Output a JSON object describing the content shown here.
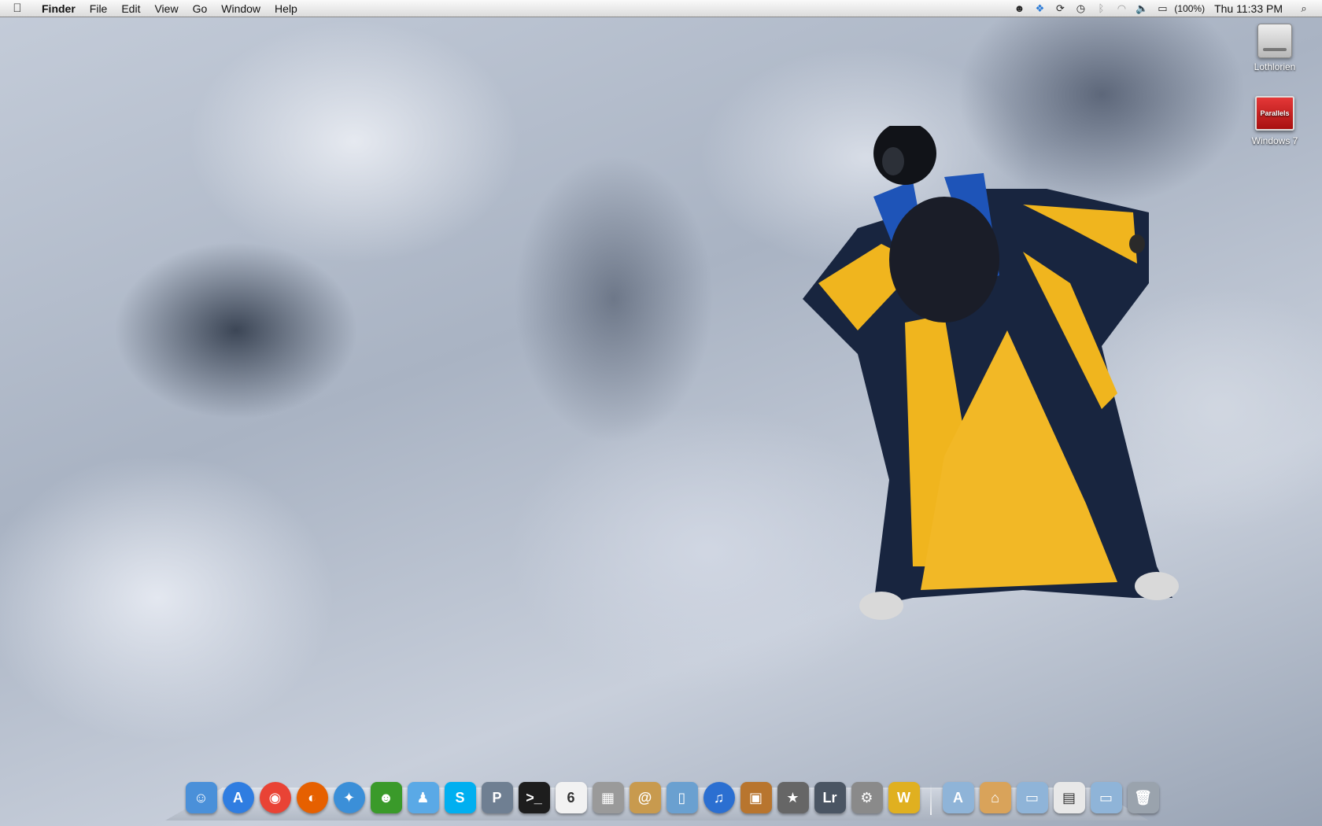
{
  "menubar": {
    "apple_icon": "apple-icon",
    "app_name": "Finder",
    "menus": [
      "File",
      "Edit",
      "View",
      "Go",
      "Window",
      "Help"
    ],
    "status_icons": [
      "monitor-app-icon",
      "dropbox-icon",
      "sync-icon",
      "time-machine-icon",
      "bluetooth-icon",
      "wifi-icon",
      "volume-icon",
      "battery-icon"
    ],
    "battery_percent": "(100%)",
    "clock": "Thu 11:33 PM",
    "spotlight_icon": "spotlight-search-icon"
  },
  "desktop_icons": [
    {
      "label": "Lothlorien",
      "icon": "hard-disk-icon"
    },
    {
      "label": "Windows 7",
      "icon": "parallels-vm-icon",
      "badge": "Parallels"
    }
  ],
  "wallpaper": "wingsuit flyer over clouds",
  "dock": {
    "apps": [
      {
        "name": "finder",
        "glyph": "☺",
        "color": "#4a90d9"
      },
      {
        "name": "app-store",
        "glyph": "A",
        "color": "#2f7de1"
      },
      {
        "name": "chrome",
        "glyph": "◉",
        "color": "#e94335"
      },
      {
        "name": "firefox",
        "glyph": "◐",
        "color": "#e66000"
      },
      {
        "name": "safari",
        "glyph": "✦",
        "color": "#3b8fd8"
      },
      {
        "name": "adium",
        "glyph": "☻",
        "color": "#3a9a2a"
      },
      {
        "name": "messenger",
        "glyph": "♟",
        "color": "#5aa9e6"
      },
      {
        "name": "skype",
        "glyph": "S",
        "color": "#00aff0"
      },
      {
        "name": "pandora",
        "glyph": "P",
        "color": "#6f7f92"
      },
      {
        "name": "terminal",
        "glyph": ">_",
        "color": "#1d1d1d"
      },
      {
        "name": "ical",
        "glyph": "6",
        "color": "#f2f2f2"
      },
      {
        "name": "calculator",
        "glyph": "▦",
        "color": "#9a9a9a"
      },
      {
        "name": "address-book",
        "glyph": "@",
        "color": "#c89a4e"
      },
      {
        "name": "preview",
        "glyph": "▯",
        "color": "#6aa0d0"
      },
      {
        "name": "itunes",
        "glyph": "♫",
        "color": "#2b6fd1"
      },
      {
        "name": "iphoto",
        "glyph": "▣",
        "color": "#b8752e"
      },
      {
        "name": "imovie",
        "glyph": "★",
        "color": "#666666"
      },
      {
        "name": "lightroom",
        "glyph": "Lr",
        "color": "#4a5563"
      },
      {
        "name": "system-preferences",
        "glyph": "⚙",
        "color": "#8a8a8a"
      },
      {
        "name": "winamp",
        "glyph": "W",
        "color": "#e0b020"
      }
    ],
    "folders": [
      {
        "name": "applications-folder",
        "glyph": "A",
        "color": "#8fb4d8"
      },
      {
        "name": "home-folder",
        "glyph": "⌂",
        "color": "#d9a35a"
      },
      {
        "name": "documents-folder",
        "glyph": "▭",
        "color": "#8fb4d8"
      },
      {
        "name": "downloads-stack",
        "glyph": "▤",
        "color": "#e8e8e8"
      },
      {
        "name": "shared-folder",
        "glyph": "▭",
        "color": "#8fb4d8"
      },
      {
        "name": "trash",
        "glyph": "🗑",
        "color": "#9aa3ad"
      }
    ]
  }
}
